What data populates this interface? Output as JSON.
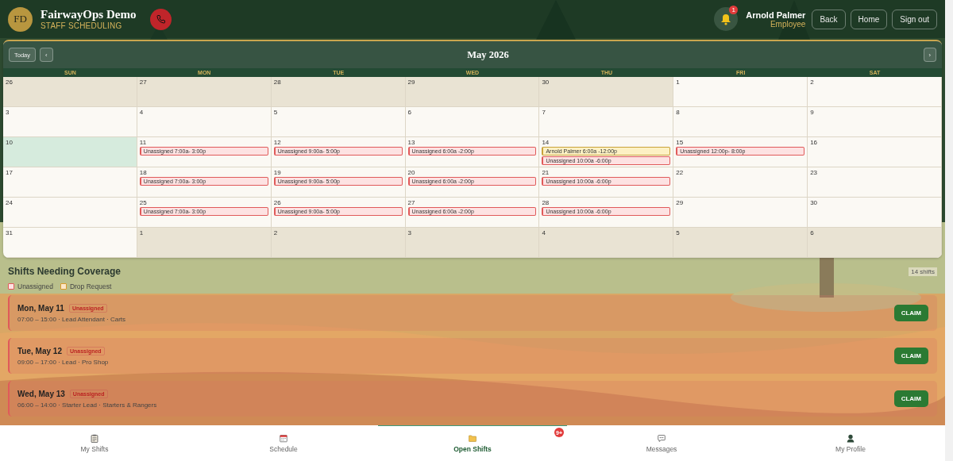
{
  "header": {
    "logo": "FD",
    "title": "FairwayOps Demo",
    "subtitle": "STAFF SCHEDULING",
    "notifications": "1",
    "user_name": "Arnold Palmer",
    "user_role": "Employee",
    "buttons": [
      "Back",
      "Home",
      "Sign out"
    ]
  },
  "calendar": {
    "today_button": "Today",
    "prev": "‹",
    "next": "›",
    "title": "May 2026",
    "weekdays": [
      "SUN",
      "MON",
      "TUE",
      "WED",
      "THU",
      "FRI",
      "SAT"
    ],
    "weeks": [
      [
        {
          "day": "26",
          "muted": true,
          "today": false
        },
        {
          "day": "27",
          "muted": true,
          "today": false
        },
        {
          "day": "28",
          "muted": true,
          "today": false
        },
        {
          "day": "29",
          "muted": true,
          "today": false
        },
        {
          "day": "30",
          "muted": true,
          "today": false
        },
        {
          "day": "1",
          "muted": false,
          "today": false
        },
        {
          "day": "2",
          "muted": false,
          "today": false
        }
      ],
      [
        {
          "day": "3",
          "muted": false,
          "today": false
        },
        {
          "day": "4",
          "muted": false,
          "today": false
        },
        {
          "day": "5",
          "muted": false,
          "today": false
        },
        {
          "day": "6",
          "muted": false,
          "today": false
        },
        {
          "day": "7",
          "muted": false,
          "today": false
        },
        {
          "day": "8",
          "muted": false,
          "today": false
        },
        {
          "day": "9",
          "muted": false,
          "today": false
        }
      ],
      [
        {
          "day": "10",
          "muted": false,
          "today": true
        },
        {
          "day": "11",
          "muted": false,
          "today": false,
          "events": [
            {
              "kind": "unassigned",
              "label": "Unassigned 7:00a- 3:00p"
            }
          ]
        },
        {
          "day": "12",
          "muted": false,
          "today": false,
          "events": [
            {
              "kind": "unassigned",
              "label": "Unassigned 9:00a- 5:00p"
            }
          ]
        },
        {
          "day": "13",
          "muted": false,
          "today": false,
          "events": [
            {
              "kind": "unassigned",
              "label": "Unassigned 6:00a -2:00p"
            }
          ]
        },
        {
          "day": "14",
          "muted": false,
          "today": false,
          "events": [
            {
              "kind": "assigned",
              "label": "Arnold Palmer 6:00a -12:00p"
            },
            {
              "kind": "unassigned",
              "label": "Unassigned 10:00a -6:00p"
            }
          ]
        },
        {
          "day": "15",
          "muted": false,
          "today": false,
          "events": [
            {
              "kind": "unassigned",
              "label": "Unassigned 12:00p- 8:00p"
            }
          ]
        },
        {
          "day": "16",
          "muted": false,
          "today": false
        }
      ],
      [
        {
          "day": "17",
          "muted": false,
          "today": false
        },
        {
          "day": "18",
          "muted": false,
          "today": false,
          "events": [
            {
              "kind": "unassigned",
              "label": "Unassigned 7:00a- 3:00p"
            }
          ]
        },
        {
          "day": "19",
          "muted": false,
          "today": false,
          "events": [
            {
              "kind": "unassigned",
              "label": "Unassigned 9:00a- 5:00p"
            }
          ]
        },
        {
          "day": "20",
          "muted": false,
          "today": false,
          "events": [
            {
              "kind": "unassigned",
              "label": "Unassigned 6:00a -2:00p"
            }
          ]
        },
        {
          "day": "21",
          "muted": false,
          "today": false,
          "events": [
            {
              "kind": "unassigned",
              "label": "Unassigned 10:00a -6:00p"
            }
          ]
        },
        {
          "day": "22",
          "muted": false,
          "today": false
        },
        {
          "day": "23",
          "muted": false,
          "today": false
        }
      ],
      [
        {
          "day": "24",
          "muted": false,
          "today": false
        },
        {
          "day": "25",
          "muted": false,
          "today": false,
          "events": [
            {
              "kind": "unassigned",
              "label": "Unassigned 7:00a- 3:00p"
            }
          ]
        },
        {
          "day": "26",
          "muted": false,
          "today": false,
          "events": [
            {
              "kind": "unassigned",
              "label": "Unassigned 9:00a- 5:00p"
            }
          ]
        },
        {
          "day": "27",
          "muted": false,
          "today": false,
          "events": [
            {
              "kind": "unassigned",
              "label": "Unassigned 6:00a -2:00p"
            }
          ]
        },
        {
          "day": "28",
          "muted": false,
          "today": false,
          "events": [
            {
              "kind": "unassigned",
              "label": "Unassigned 10:00a -6:00p"
            }
          ]
        },
        {
          "day": "29",
          "muted": false,
          "today": false
        },
        {
          "day": "30",
          "muted": false,
          "today": false
        }
      ],
      [
        {
          "day": "31",
          "muted": false,
          "today": false
        },
        {
          "day": "1",
          "muted": true,
          "today": false
        },
        {
          "day": "2",
          "muted": true,
          "today": false
        },
        {
          "day": "3",
          "muted": true,
          "today": false
        },
        {
          "day": "4",
          "muted": true,
          "today": false
        },
        {
          "day": "5",
          "muted": true,
          "today": false
        },
        {
          "day": "6",
          "muted": true,
          "today": false
        }
      ]
    ]
  },
  "coverage": {
    "title": "Shifts Needing Coverage",
    "count": "14 shifts",
    "legend": [
      {
        "kind": "unassigned",
        "label": "Unassigned"
      },
      {
        "kind": "drop",
        "label": "Drop Request"
      }
    ],
    "shifts": [
      {
        "kind": "unassigned",
        "date": "Mon, May 11",
        "status": "Unassigned",
        "details": "07:00 – 15:00 · Lead Attendant · Carts",
        "action": "CLAIM"
      },
      {
        "kind": "unassigned",
        "date": "Tue, May 12",
        "status": "Unassigned",
        "details": "09:00 – 17:00 · Lead · Pro Shop",
        "action": "CLAIM"
      },
      {
        "kind": "unassigned",
        "date": "Wed, May 13",
        "status": "Unassigned",
        "details": "06:00 – 14:00 · Starter Lead · Starters & Rangers",
        "action": "CLAIM"
      }
    ]
  },
  "nav": [
    {
      "label": "My Shifts",
      "selected": false
    },
    {
      "label": "Schedule",
      "selected": false
    },
    {
      "label": "Open Shifts",
      "selected": true,
      "badge": "9+"
    },
    {
      "label": "Messages",
      "selected": false
    },
    {
      "label": "My Profile",
      "selected": false
    }
  ]
}
